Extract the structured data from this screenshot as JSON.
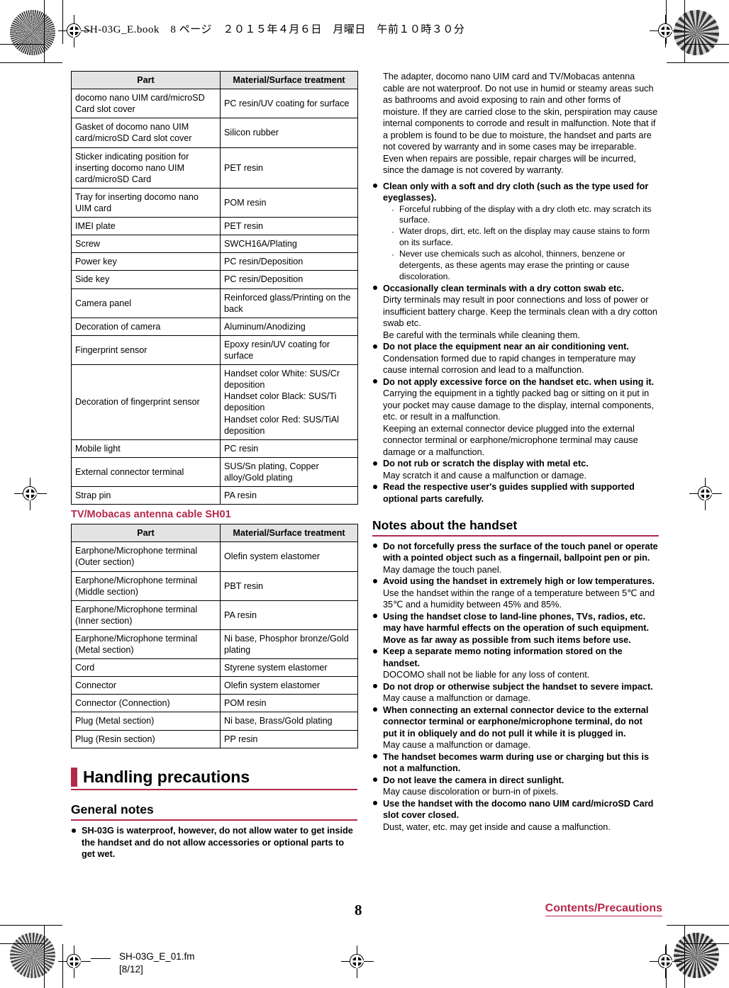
{
  "meta": {
    "header_slug": "SH-03G_E.book　8 ページ　２０１５年４月６日　月曜日　午前１０時３０分",
    "page_number": "8",
    "breadcrumb": "Contents/Precautions",
    "file_name": "SH-03G_E_01.fm",
    "file_page": "[8/12]",
    "accent_color": "#b4294a",
    "header_fill": "#e3e3e3"
  },
  "table_handset": {
    "columns": [
      "Part",
      "Material/Surface treatment"
    ],
    "rows": [
      [
        "docomo nano UIM card/microSD Card slot cover",
        "PC resin/UV coating for surface"
      ],
      [
        "Gasket of docomo nano UIM card/microSD Card slot cover",
        "Silicon rubber"
      ],
      [
        "Sticker indicating position for inserting docomo nano UIM card/microSD Card",
        "PET resin"
      ],
      [
        "Tray for inserting docomo nano UIM card",
        "POM resin"
      ],
      [
        "IMEI plate",
        "PET resin"
      ],
      [
        "Screw",
        "SWCH16A/Plating"
      ],
      [
        "Power key",
        "PC resin/Deposition"
      ],
      [
        "Side key",
        "PC resin/Deposition"
      ],
      [
        "Camera panel",
        "Reinforced glass/Printing on the back"
      ],
      [
        "Decoration of camera",
        "Aluminum/Anodizing"
      ],
      [
        "Fingerprint sensor",
        "Epoxy resin/UV coating for surface"
      ],
      [
        "Decoration of fingerprint sensor",
        "Handset color White: SUS/Cr deposition\nHandset color Black: SUS/Ti deposition\nHandset color Red: SUS/TiAl deposition"
      ],
      [
        "Mobile light",
        "PC resin"
      ],
      [
        "External connector terminal",
        "SUS/Sn plating, Copper alloy/Gold plating"
      ],
      [
        "Strap pin",
        "PA resin"
      ]
    ]
  },
  "cable_section": {
    "title": "TV/Mobacas antenna cable SH01",
    "columns": [
      "Part",
      "Material/Surface treatment"
    ],
    "rows": [
      [
        "Earphone/Microphone terminal (Outer section)",
        "Olefin system elastomer"
      ],
      [
        "Earphone/Microphone terminal (Middle section)",
        "PBT resin"
      ],
      [
        "Earphone/Microphone terminal (Inner section)",
        "PA resin"
      ],
      [
        "Earphone/Microphone terminal (Metal section)",
        "Ni base, Phosphor bronze/Gold plating"
      ],
      [
        "Cord",
        "Styrene system elastomer"
      ],
      [
        "Connector",
        "Olefin system elastomer"
      ],
      [
        "Connector (Connection)",
        "POM resin"
      ],
      [
        "Plug (Metal section)",
        "Ni base, Brass/Gold plating"
      ],
      [
        "Plug (Resin section)",
        "PP resin"
      ]
    ]
  },
  "handling": {
    "heading": "Handling precautions",
    "general": {
      "heading": "General notes",
      "items": [
        {
          "strong": "SH-03G is waterproof, however, do not allow water to get inside the handset and do not allow accessories or optional parts to get wet."
        }
      ]
    }
  },
  "right_column": {
    "lead_paragraph": "The adapter, docomo nano UIM card and TV/Mobacas antenna cable are not waterproof. Do not use in humid or steamy areas such as bathrooms and avoid exposing to rain and other forms of moisture. If they are carried close to the skin, perspiration may cause internal components to corrode and result in malfunction. Note that if a problem is found to be due to moisture, the handset and parts are not covered by warranty and in some cases may be irreparable. Even when repairs are possible, repair charges will be incurred, since the damage is not covered by warranty.",
    "items": [
      {
        "strong": "Clean only with a soft and dry cloth (such as the type used for eyeglasses).",
        "subs": [
          "Forceful rubbing of the display with a dry cloth etc. may scratch its surface.",
          "Water drops, dirt, etc. left on the display may cause stains to form on its surface.",
          "Never use chemicals such as alcohol, thinners, benzene or detergents, as these agents may erase the printing or cause discoloration."
        ]
      },
      {
        "strong": "Occasionally clean terminals with a dry cotton swab etc.",
        "notes": [
          "Dirty terminals may result in poor connections and loss of power or insufficient battery charge. Keep the terminals clean with a dry cotton swab etc.",
          "Be careful with the terminals while cleaning them."
        ]
      },
      {
        "strong": "Do not place the equipment near an air conditioning vent.",
        "notes": [
          "Condensation formed due to rapid changes in temperature may cause internal corrosion and lead to a malfunction."
        ]
      },
      {
        "strong": "Do not apply excessive force on the handset etc. when using it.",
        "notes": [
          "Carrying the equipment in a tightly packed bag or sitting on it put in your pocket may cause damage to the display, internal components, etc. or result in a malfunction.",
          "Keeping an external connector device plugged into the external connector terminal or earphone/microphone terminal may cause damage or a malfunction."
        ]
      },
      {
        "strong": "Do not rub or scratch the display with metal etc.",
        "notes": [
          "May scratch it and cause a malfunction or damage."
        ]
      },
      {
        "strong": "Read the respective user's guides supplied with supported optional parts carefully."
      }
    ],
    "notes_handset": {
      "heading": "Notes about the handset",
      "items": [
        {
          "strong": "Do not forcefully press the surface of the touch panel or operate with a pointed object such as a fingernail, ballpoint pen or pin.",
          "notes": [
            "May damage the touch panel."
          ]
        },
        {
          "strong": "Avoid using the handset in extremely high or low temperatures.",
          "notes": [
            "Use the handset within the range of a temperature between 5℃ and 35℃ and a humidity between 45% and 85%."
          ]
        },
        {
          "strong": "Using the handset close to land-line phones, TVs, radios, etc. may have harmful effects on the operation of such equipment. Move as far away as possible from such items before use."
        },
        {
          "strong": "Keep a separate memo noting information stored on the handset.",
          "notes": [
            "DOCOMO shall not be liable for any loss of content."
          ]
        },
        {
          "strong": "Do not drop or otherwise subject the handset to severe impact.",
          "notes": [
            "May cause a malfunction or damage."
          ]
        },
        {
          "strong": "When connecting an external connector device to the external connector terminal or earphone/microphone terminal, do not put it in obliquely and do not pull it while it is plugged in.",
          "notes": [
            "May cause a malfunction or damage."
          ]
        },
        {
          "strong": "The handset becomes warm during use or charging but this is not a malfunction."
        },
        {
          "strong": "Do not leave the camera in direct sunlight.",
          "notes": [
            "May cause discoloration or burn-in of pixels."
          ]
        },
        {
          "strong": "Use the handset with the docomo nano UIM card/microSD Card slot cover closed.",
          "notes": [
            "Dust, water, etc. may get inside and cause a malfunction."
          ]
        }
      ]
    }
  }
}
